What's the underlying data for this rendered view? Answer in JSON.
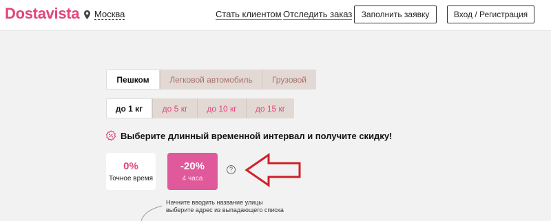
{
  "header": {
    "logo": "Dostavista",
    "city": "Москва",
    "icons": {
      "city": "map-pin-icon"
    },
    "links": {
      "client": "Стать клиентом",
      "track": "Отследить заказ"
    },
    "buttons": {
      "apply": "Заполнить заявку",
      "login": "Вход / Регистрация"
    }
  },
  "transport": {
    "options": [
      "Пешком",
      "Легковой автомобиль",
      "Грузовой"
    ],
    "selected": "Пешком"
  },
  "weight": {
    "options": [
      "до 1 кг",
      "до 5 кг",
      "до 10 кг",
      "до 15 кг"
    ],
    "selected": "до 1 кг"
  },
  "promo": {
    "icon": "discount-badge-icon",
    "text": "Выберите длинный временной интервал и получите скидку!"
  },
  "intervals": [
    {
      "discount": "0%",
      "label": "Точное время",
      "selected": false
    },
    {
      "discount": "-20%",
      "label": "4 часа",
      "selected": true
    }
  ],
  "help_icon": "?",
  "annotation": {
    "icon": "red-arrow-icon",
    "color": "#d0202a"
  },
  "hint": {
    "line1": "Начните вводить название улицы",
    "line2": "выберите адрес из выпадающего списка"
  },
  "colors": {
    "brand": "#e0457b",
    "selected_card": "#e0599b"
  }
}
